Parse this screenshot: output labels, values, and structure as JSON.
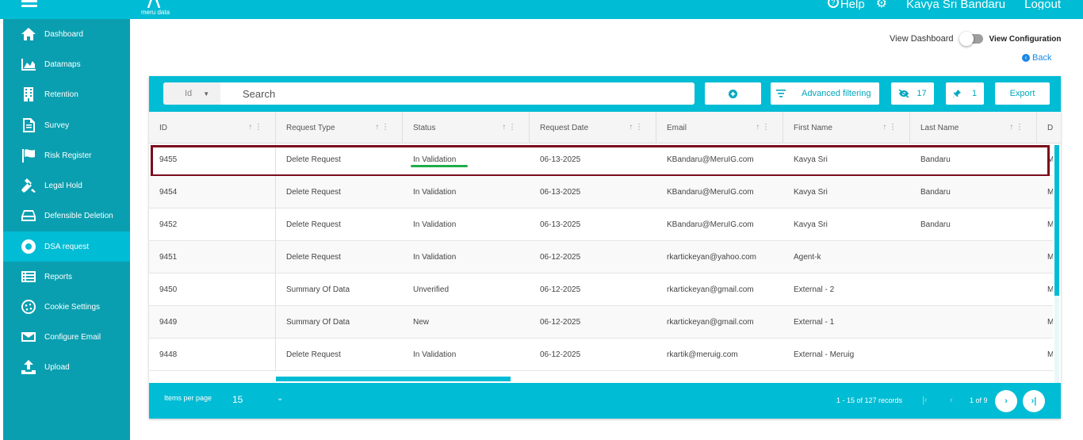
{
  "header": {
    "logo_text": "meru data",
    "help_label": "Help",
    "user_name": "Kavya Sri Bandaru",
    "logout_label": "Logout"
  },
  "sidebar": {
    "items": [
      {
        "label": "Dashboard",
        "icon": "home-icon"
      },
      {
        "label": "Datamaps",
        "icon": "chart-area-icon"
      },
      {
        "label": "Retention",
        "icon": "building-icon"
      },
      {
        "label": "Survey",
        "icon": "document-icon"
      },
      {
        "label": "Risk Register",
        "icon": "flag-icon"
      },
      {
        "label": "Legal Hold",
        "icon": "gavel-icon"
      },
      {
        "label": "Defensible Deletion",
        "icon": "hard-drive-icon"
      },
      {
        "label": "DSA request",
        "icon": "lifebuoy-icon",
        "active": true
      },
      {
        "label": "Reports",
        "icon": "list-icon"
      },
      {
        "label": "Cookie Settings",
        "icon": "cookie-icon"
      },
      {
        "label": "Configure Email",
        "icon": "envelope-icon"
      },
      {
        "label": "Upload",
        "icon": "upload-icon"
      }
    ]
  },
  "view_toggle": {
    "left_label": "View Dashboard",
    "right_label": "View Configuration"
  },
  "back_label": "Back",
  "toolbar": {
    "search_field": "Id",
    "search_placeholder": "Search",
    "advanced_filter_label": "Advanced filtering",
    "hidden_count": "17",
    "pinned_count": "1",
    "export_label": "Export"
  },
  "columns": [
    "ID",
    "Request Type",
    "Status",
    "Request Date",
    "Email",
    "First Name",
    "Last Name",
    "D"
  ],
  "rows": [
    [
      "9455",
      "Delete Request",
      "In Validation",
      "06-13-2025",
      "KBandaru@MeruIG.com",
      "Kavya Sri",
      "Bandaru",
      "M"
    ],
    [
      "9454",
      "Delete Request",
      "In Validation",
      "06-13-2025",
      "KBandaru@MeruIG.com",
      "Kavya Sri",
      "Bandaru",
      "M"
    ],
    [
      "9452",
      "Delete Request",
      "In Validation",
      "06-13-2025",
      "KBandaru@MeruIG.com",
      "Kavya Sri",
      "Bandaru",
      "M"
    ],
    [
      "9451",
      "Delete Request",
      "In Validation",
      "06-12-2025",
      "rkartickeyan@yahoo.com",
      "Agent-k",
      "",
      "M"
    ],
    [
      "9450",
      "Summary Of Data",
      "Unverified",
      "06-12-2025",
      "rkartickeyan@gmail.com",
      "External - 2",
      "",
      "M"
    ],
    [
      "9449",
      "Summary Of Data",
      "New",
      "06-12-2025",
      "rkartickeyan@gmail.com",
      "External - 1",
      "",
      "M"
    ],
    [
      "9448",
      "Delete Request",
      "In Validation",
      "06-12-2025",
      "rkartik@meruig.com",
      "External - Meruig",
      "",
      "M"
    ]
  ],
  "footer": {
    "items_per_page_label": "Items per page",
    "items_per_page_value": "15",
    "records_text": "1 - 15 of 127 records",
    "page_text": "1 of 9"
  },
  "colors": {
    "primary": "#00bcd4",
    "sidebar": "#0a9fb0",
    "highlight_border": "#7b0c1c",
    "status_underline": "#1fae4a"
  }
}
